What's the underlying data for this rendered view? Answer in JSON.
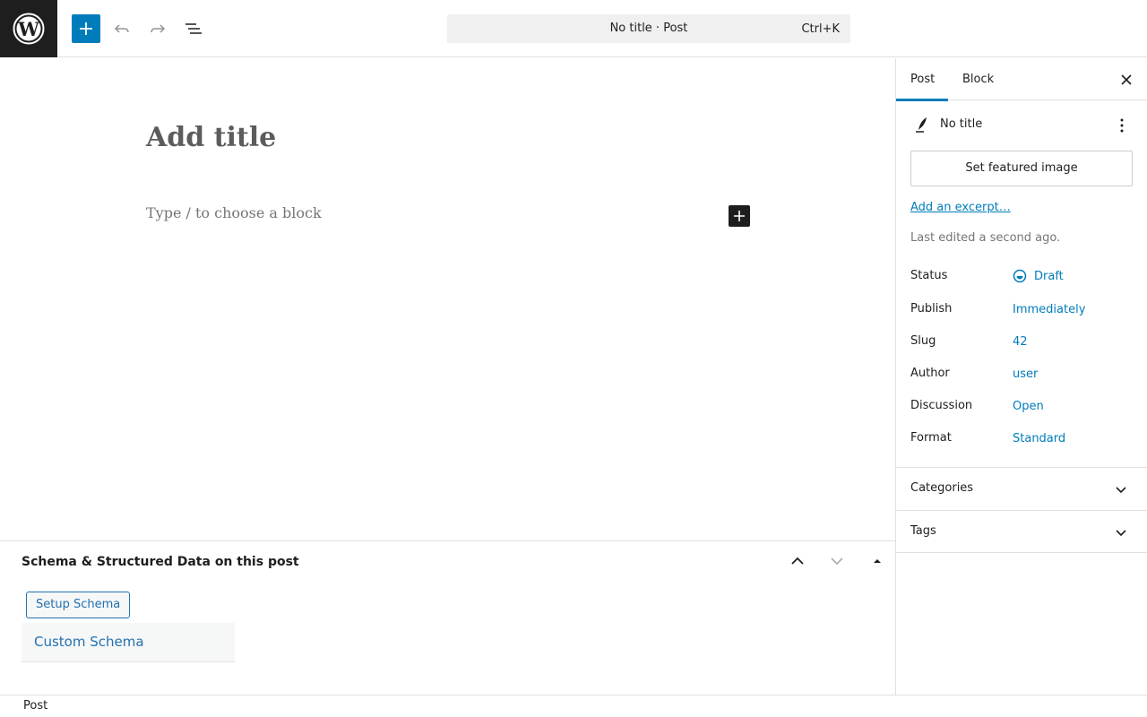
{
  "toolbar": {
    "logo_icon": "wordpress-logo-icon",
    "add_block_icon": "plus-icon",
    "undo_icon": "undo-icon",
    "redo_icon": "redo-icon",
    "list_view_icon": "list-view-icon",
    "command": {
      "title": "No title · Post",
      "shortcut": "Ctrl+K"
    }
  },
  "editor": {
    "title_placeholder": "Add title",
    "block_placeholder": "Type / to choose a block",
    "inserter_icon": "plus-icon"
  },
  "metabox": {
    "title": "Schema & Structured Data on this post",
    "setup_button": "Setup Schema",
    "custom_schema_link": "Custom Schema"
  },
  "footer": {
    "breadcrumb": "Post"
  },
  "sidebar": {
    "tabs": [
      {
        "label": "Post",
        "active": true
      },
      {
        "label": "Block",
        "active": false
      }
    ],
    "close_icon": "close-icon",
    "post_title": "No title",
    "featured_image_button": "Set featured image",
    "excerpt_link": "Add an excerpt…",
    "last_edited": "Last edited a second ago.",
    "rows": [
      {
        "label": "Status",
        "value": "Draft"
      },
      {
        "label": "Publish",
        "value": "Immediately"
      },
      {
        "label": "Slug",
        "value": "42"
      },
      {
        "label": "Author",
        "value": "user"
      },
      {
        "label": "Discussion",
        "value": "Open"
      },
      {
        "label": "Format",
        "value": "Standard"
      }
    ],
    "panels": [
      {
        "title": "Categories",
        "expanded": false
      },
      {
        "title": "Tags",
        "expanded": false
      }
    ]
  },
  "colors": {
    "accent": "#007cba",
    "link": "#2271b1",
    "dark": "#1e1e1e"
  }
}
